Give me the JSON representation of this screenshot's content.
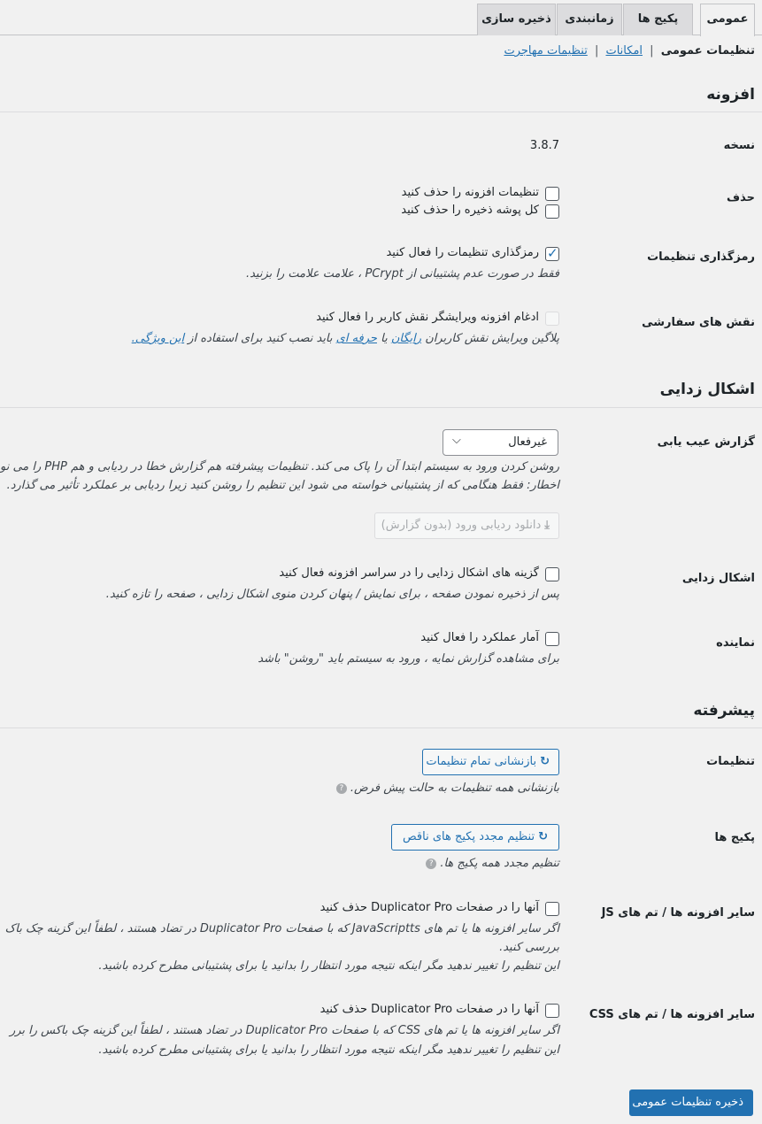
{
  "tabs": [
    "عمومی",
    "پکیج ها",
    "زمانبندی",
    "ذخیره سازی"
  ],
  "subnav": {
    "current": "تنظیمات عمومی",
    "links": [
      "امکانات",
      "تنظیمات مهاجرت"
    ]
  },
  "sections": {
    "plugin": "افزونه",
    "debug": "اشکال زدایی",
    "advanced": "پیشرفته"
  },
  "plugin": {
    "version_label": "نسخه",
    "version_value": "3.8.7",
    "delete_label": "حذف",
    "delete_opt1": "تنظیمات افزونه را حذف کنید",
    "delete_opt2": "کل پوشه ذخیره را حذف کنید",
    "encrypt_label": "رمزگذاری تنظیمات",
    "encrypt_opt": "رمزگذاری تنظیمات را فعال کنید",
    "encrypt_desc": "فقط در صورت عدم پشتیبانی از PCrypt ، علامت علامت را بزنید.",
    "roles_label": "نقش های سفارشی",
    "roles_opt": "ادغام افزونه ویرایشگر نقش کاربر را فعال کنید",
    "roles_desc_prefix": "پلاگین ویرایش نقش کاربران",
    "roles_link_free": "رایگان",
    "roles_or": "یا",
    "roles_link_pro": "حرفه ای",
    "roles_desc_mid": "باید نصب کنید برای استفاده از",
    "roles_link_feature": "این ویژگی."
  },
  "debug": {
    "trace_label": "گزارش عیب یابی",
    "trace_value": "غیرفعال",
    "trace_desc1": "روشن کردن ورود به سیستم ابتدا آن را پاک می کند. تنظیمات پیشرفته هم گزارش خطا در ردیابی و هم PHP را می نو",
    "trace_desc2": "اخطار: فقط هنگامی که از پشتیبانی خواسته می شود این تنظیم را روشن کنید زیرا ردیابی بر عملکرد تأثیر می گذارد.",
    "trace_download": "دانلود ردیابی ورود (بدون گزارش)",
    "debug_label": "اشکال زدایی",
    "debug_opt": "گزینه های اشکال زدایی را در سراسر افزونه فعال کنید",
    "debug_desc": "پس از ذخیره نمودن صفحه ، برای نمایش / پنهان کردن منوی اشکال زدایی ، صفحه را تازه کنید.",
    "profile_label": "نماینده",
    "profile_opt": "آمار عملکرد را فعال کنید",
    "profile_desc": "برای مشاهده گزارش نمایه ، ورود به سیستم باید \"روشن\" باشد"
  },
  "advanced": {
    "settings_label": "تنظیمات",
    "settings_btn": "بازنشانی تمام تنظیمات",
    "settings_desc": "بازنشانی همه تنظیمات به حالت پیش فرض.",
    "packages_label": "پکیج ها",
    "packages_btn": "تنظیم مجدد پکیج های ناقص",
    "packages_desc": "تنظیم مجدد همه پکیج ها.",
    "js_label": "سایر افزونه ها / تم های JS",
    "js_opt": "آنها را در صفحات Duplicator Pro حذف کنید",
    "js_desc1": "اگر سایر افزونه ها یا تم های JavaScriptts که با صفحات Duplicator Pro در تضاد هستند ، لطفاً این گزینه چک باک",
    "js_desc2": "بررسی کنید.",
    "js_desc3": "این تنظیم را تغییر ندهید مگر اینکه نتیجه مورد انتظار را بدانید یا برای پشتیبانی مطرح کرده باشید.",
    "css_label": "سایر افزونه ها / تم های CSS",
    "css_opt": "آنها را در صفحات Duplicator Pro حذف کنید",
    "css_desc1": "اگر سایر افزونه ها یا تم های CSS که با صفحات Duplicator Pro در تضاد هستند ، لطفاً این گزینه چک باکس را برر",
    "css_desc2": "این تنظیم را تغییر ندهید مگر اینکه نتیجه مورد انتظار را بدانید یا برای پشتیبانی مطرح کرده باشید."
  },
  "save_button": "ذخیره تنظیمات عمومی",
  "icons": {
    "checkbox_checked": "check-icon",
    "select": "chevron-down-icon",
    "download": "download-icon",
    "reset": "refresh-icon",
    "help": "help-icon"
  },
  "colors": {
    "accent": "#2271b1",
    "page_bg": "#f1f1f1"
  }
}
